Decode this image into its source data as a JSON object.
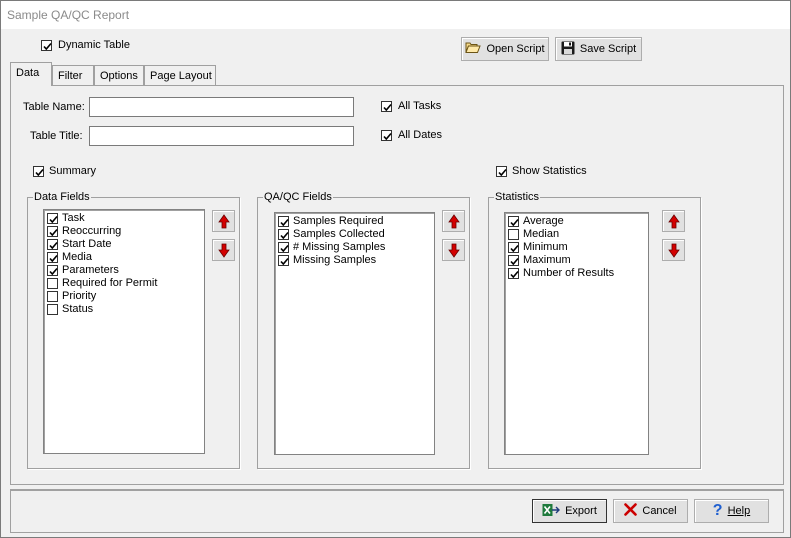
{
  "window": {
    "title": "Sample QA/QC Report"
  },
  "top": {
    "dynamic_table": {
      "label": "Dynamic Table",
      "checked": true
    },
    "open_script_label": "Open Script",
    "save_script_label": "Save Script"
  },
  "tabs": [
    {
      "label": "Data",
      "active": true
    },
    {
      "label": "Filter",
      "active": false
    },
    {
      "label": "Options",
      "active": false
    },
    {
      "label": "Page Layout",
      "active": false
    }
  ],
  "data_tab": {
    "table_name": {
      "label": "Table Name:",
      "value": ""
    },
    "table_title": {
      "label": "Table Title:",
      "value": ""
    },
    "all_tasks": {
      "label": "All Tasks",
      "checked": true
    },
    "all_dates": {
      "label": "All Dates",
      "checked": true
    },
    "summary": {
      "label": "Summary",
      "checked": true
    },
    "show_statistics": {
      "label": "Show Statistics",
      "checked": true
    },
    "data_fields": {
      "title": "Data Fields",
      "items": [
        {
          "label": "Task",
          "checked": true
        },
        {
          "label": "Reoccurring",
          "checked": true
        },
        {
          "label": "Start Date",
          "checked": true
        },
        {
          "label": "Media",
          "checked": true
        },
        {
          "label": "Parameters",
          "checked": true
        },
        {
          "label": "Required for Permit",
          "checked": false
        },
        {
          "label": "Priority",
          "checked": false
        },
        {
          "label": "Status",
          "checked": false
        }
      ]
    },
    "qaqc_fields": {
      "title": "QA/QC Fields",
      "items": [
        {
          "label": "Samples Required",
          "checked": true
        },
        {
          "label": "Samples Collected",
          "checked": true
        },
        {
          "label": "# Missing Samples",
          "checked": true
        },
        {
          "label": "Missing Samples",
          "checked": true
        }
      ]
    },
    "statistics": {
      "title": "Statistics",
      "items": [
        {
          "label": "Average",
          "checked": true
        },
        {
          "label": "Median",
          "checked": false
        },
        {
          "label": "Minimum",
          "checked": true
        },
        {
          "label": "Maximum",
          "checked": true
        },
        {
          "label": "Number of Results",
          "checked": true
        }
      ]
    }
  },
  "footer": {
    "export_label": "Export",
    "cancel_label": "Cancel",
    "help_label": "Help"
  },
  "colors": {
    "arrow_red": "#d40000",
    "cancel_red": "#cc0000",
    "help_blue": "#1f5fd0",
    "export_green": "#1e7a3c"
  }
}
